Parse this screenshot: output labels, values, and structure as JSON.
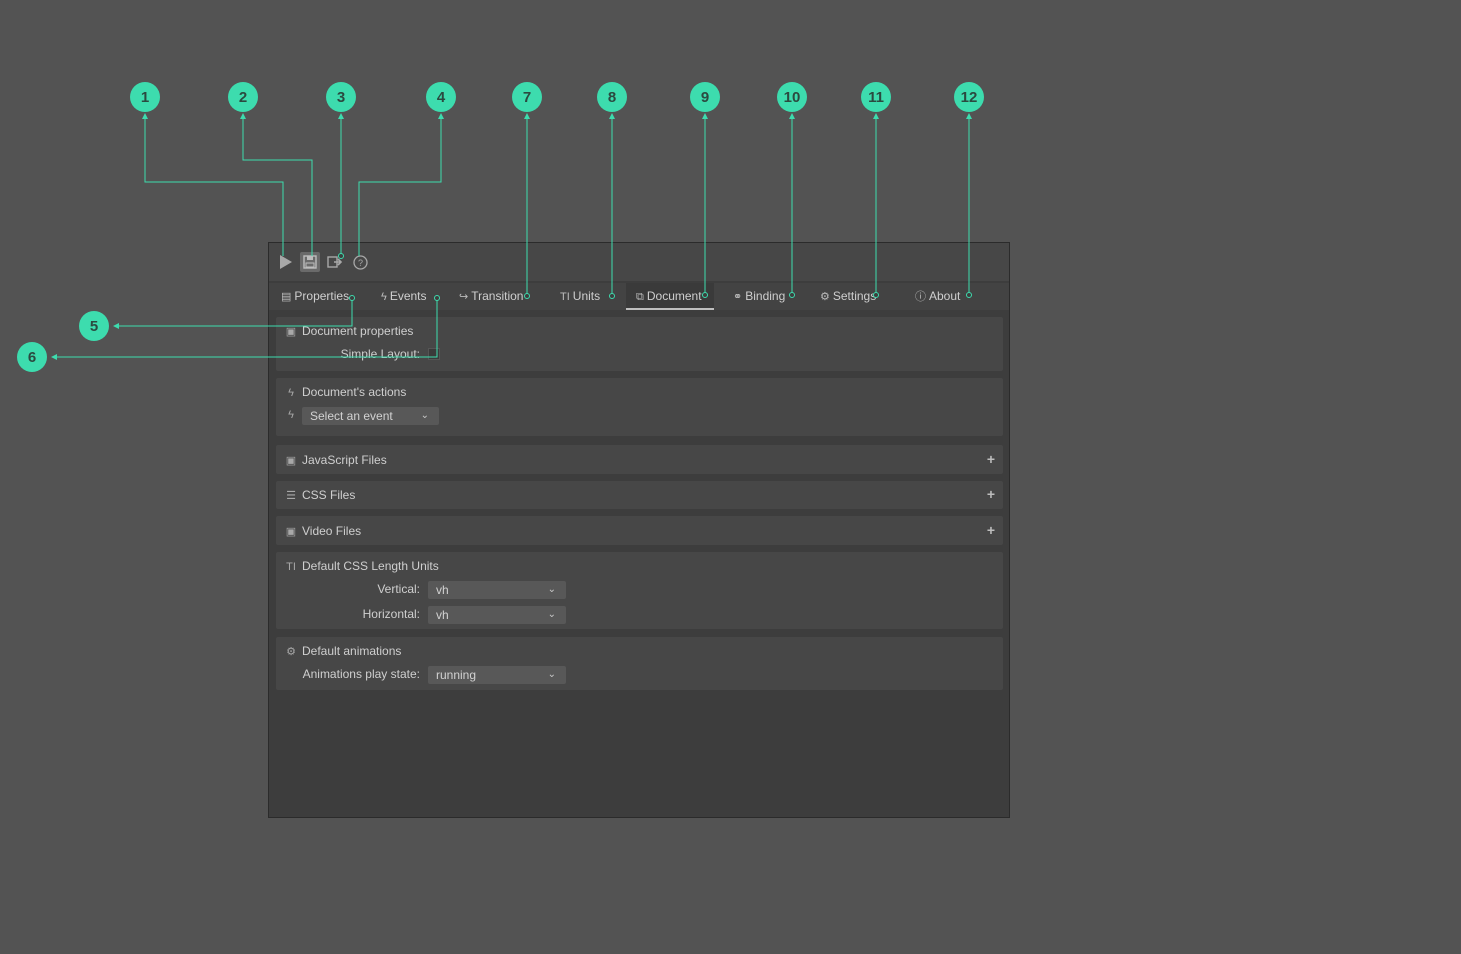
{
  "colors": {
    "background": "#535353",
    "panel": "#3d3d3d",
    "section": "#474747",
    "callout_accent": "#3ddcae"
  },
  "toolbar": {
    "buttons": [
      {
        "name": "play",
        "icon": "play-icon"
      },
      {
        "name": "save",
        "icon": "save-icon",
        "active": true
      },
      {
        "name": "export",
        "icon": "export-icon"
      },
      {
        "name": "help",
        "icon": "help-icon"
      }
    ]
  },
  "tabs": [
    {
      "label": "Properties",
      "icon": "properties-icon"
    },
    {
      "label": "Events",
      "icon": "bolt-icon"
    },
    {
      "label": "Transition",
      "icon": "share-arrow-icon"
    },
    {
      "label": "Units",
      "icon": "text-units-icon"
    },
    {
      "label": "Document",
      "icon": "document-icon",
      "active": true
    },
    {
      "label": "Binding",
      "icon": "link-icon"
    },
    {
      "label": "Settings",
      "icon": "gear-icon"
    },
    {
      "label": "About",
      "icon": "info-icon"
    }
  ],
  "sections": {
    "document_properties": {
      "title": "Document properties",
      "simple_layout_label": "Simple Layout:",
      "simple_layout_checked": false
    },
    "document_actions": {
      "title": "Document's actions",
      "event_select_value": "Select an event"
    },
    "javascript_files": {
      "title": "JavaScript Files"
    },
    "css_files": {
      "title": "CSS Files"
    },
    "video_files": {
      "title": "Video Files"
    },
    "default_units": {
      "title": "Default CSS Length Units",
      "vertical_label": "Vertical:",
      "vertical_value": "vh",
      "horizontal_label": "Horizontal:",
      "horizontal_value": "vh"
    },
    "default_animations": {
      "title": "Default animations",
      "play_state_label": "Animations play state:",
      "play_state_value": "running"
    }
  },
  "callouts": [
    "1",
    "2",
    "3",
    "4",
    "5",
    "6",
    "7",
    "8",
    "9",
    "10",
    "11",
    "12"
  ]
}
